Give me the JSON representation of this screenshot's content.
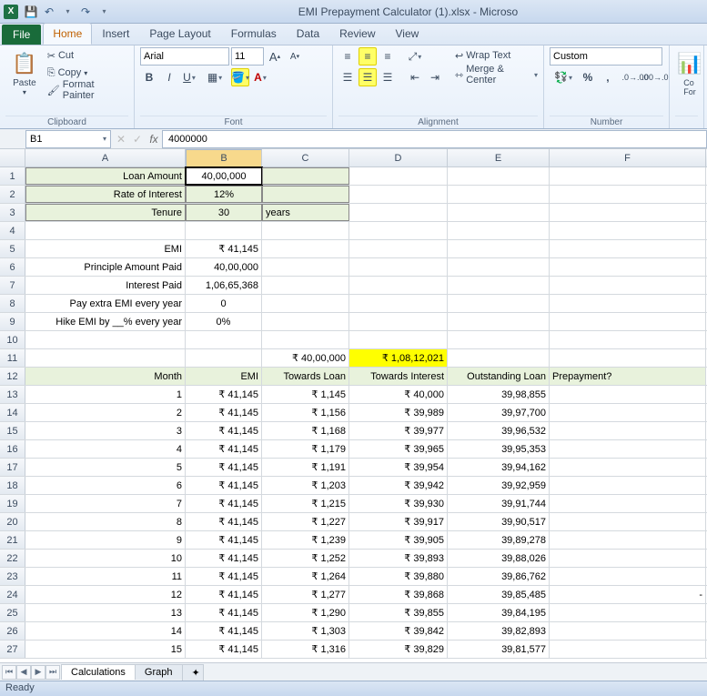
{
  "title": "EMI Prepayment Calculator (1).xlsx  -  Microso",
  "tabs": {
    "file": "File",
    "home": "Home",
    "insert": "Insert",
    "page": "Page Layout",
    "formulas": "Formulas",
    "data": "Data",
    "review": "Review",
    "view": "View"
  },
  "ribbon": {
    "clipboard": {
      "label": "Clipboard",
      "paste": "Paste",
      "cut": "Cut",
      "copy": "Copy",
      "fp": "Format Painter"
    },
    "font": {
      "label": "Font",
      "name": "Arial",
      "size": "11"
    },
    "alignment": {
      "label": "Alignment",
      "wrap": "Wrap Text",
      "merge": "Merge & Center"
    },
    "number": {
      "label": "Number",
      "fmt": "Custom"
    },
    "cond": "Co\nFor"
  },
  "namebox": "B1",
  "formula": "4000000",
  "cols": [
    "A",
    "B",
    "C",
    "D",
    "E",
    "F"
  ],
  "inputs": {
    "loan_label": "Loan Amount",
    "loan_val": "40,00,000",
    "rate_label": "Rate of Interest",
    "rate_val": "12%",
    "tenure_label": "Tenure",
    "tenure_val": "30",
    "tenure_unit": "years"
  },
  "summary": {
    "emi_label": "EMI",
    "emi_val": "₹ 41,145",
    "prin_label": "Principle Amount Paid",
    "prin_val": "40,00,000",
    "int_label": "Interest Paid",
    "int_val": "1,06,65,368",
    "extra_label": "Pay extra EMI every year",
    "extra_val": "0",
    "hike_label": "Hike EMI by __% every year",
    "hike_val": "0%"
  },
  "totals": {
    "c": "₹ 40,00,000",
    "d": "₹ 1,08,12,021"
  },
  "thead": {
    "a": "Month",
    "b": "EMI",
    "c": "Towards Loan",
    "d": "Towards Interest",
    "e": "Outstanding Loan",
    "f": "Prepayment?"
  },
  "rows": [
    {
      "n": 13,
      "m": "1",
      "emi": "₹ 41,145",
      "tl": "₹ 1,145",
      "ti": "₹ 40,000",
      "ol": "39,98,855",
      "pp": ""
    },
    {
      "n": 14,
      "m": "2",
      "emi": "₹ 41,145",
      "tl": "₹ 1,156",
      "ti": "₹ 39,989",
      "ol": "39,97,700",
      "pp": ""
    },
    {
      "n": 15,
      "m": "3",
      "emi": "₹ 41,145",
      "tl": "₹ 1,168",
      "ti": "₹ 39,977",
      "ol": "39,96,532",
      "pp": ""
    },
    {
      "n": 16,
      "m": "4",
      "emi": "₹ 41,145",
      "tl": "₹ 1,179",
      "ti": "₹ 39,965",
      "ol": "39,95,353",
      "pp": ""
    },
    {
      "n": 17,
      "m": "5",
      "emi": "₹ 41,145",
      "tl": "₹ 1,191",
      "ti": "₹ 39,954",
      "ol": "39,94,162",
      "pp": ""
    },
    {
      "n": 18,
      "m": "6",
      "emi": "₹ 41,145",
      "tl": "₹ 1,203",
      "ti": "₹ 39,942",
      "ol": "39,92,959",
      "pp": ""
    },
    {
      "n": 19,
      "m": "7",
      "emi": "₹ 41,145",
      "tl": "₹ 1,215",
      "ti": "₹ 39,930",
      "ol": "39,91,744",
      "pp": ""
    },
    {
      "n": 20,
      "m": "8",
      "emi": "₹ 41,145",
      "tl": "₹ 1,227",
      "ti": "₹ 39,917",
      "ol": "39,90,517",
      "pp": ""
    },
    {
      "n": 21,
      "m": "9",
      "emi": "₹ 41,145",
      "tl": "₹ 1,239",
      "ti": "₹ 39,905",
      "ol": "39,89,278",
      "pp": ""
    },
    {
      "n": 22,
      "m": "10",
      "emi": "₹ 41,145",
      "tl": "₹ 1,252",
      "ti": "₹ 39,893",
      "ol": "39,88,026",
      "pp": ""
    },
    {
      "n": 23,
      "m": "11",
      "emi": "₹ 41,145",
      "tl": "₹ 1,264",
      "ti": "₹ 39,880",
      "ol": "39,86,762",
      "pp": ""
    },
    {
      "n": 24,
      "m": "12",
      "emi": "₹ 41,145",
      "tl": "₹ 1,277",
      "ti": "₹ 39,868",
      "ol": "39,85,485",
      "pp": "-"
    },
    {
      "n": 25,
      "m": "13",
      "emi": "₹ 41,145",
      "tl": "₹ 1,290",
      "ti": "₹ 39,855",
      "ol": "39,84,195",
      "pp": ""
    },
    {
      "n": 26,
      "m": "14",
      "emi": "₹ 41,145",
      "tl": "₹ 1,303",
      "ti": "₹ 39,842",
      "ol": "39,82,893",
      "pp": ""
    },
    {
      "n": 27,
      "m": "15",
      "emi": "₹ 41,145",
      "tl": "₹ 1,316",
      "ti": "₹ 39,829",
      "ol": "39,81,577",
      "pp": ""
    }
  ],
  "sheets": {
    "s1": "Calculations",
    "s2": "Graph"
  },
  "status": "Ready"
}
